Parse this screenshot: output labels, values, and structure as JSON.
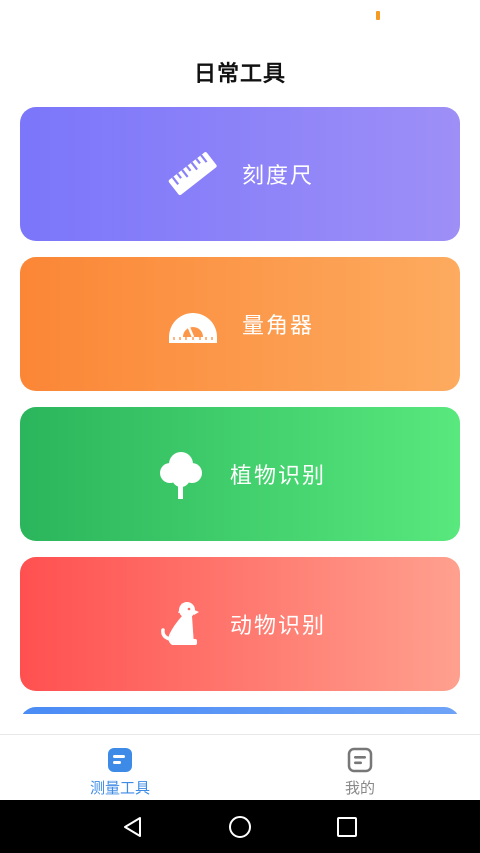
{
  "header": {
    "title": "日常工具"
  },
  "tools": [
    {
      "label": "刻度尺",
      "icon": "ruler-icon"
    },
    {
      "label": "量角器",
      "icon": "protractor-icon"
    },
    {
      "label": "植物识别",
      "icon": "tree-icon"
    },
    {
      "label": "动物识别",
      "icon": "dog-icon"
    }
  ],
  "tab_bar": {
    "tabs": [
      {
        "label": "测量工具",
        "icon": "document-icon",
        "active": true
      },
      {
        "label": "我的",
        "icon": "document-outline-icon",
        "active": false
      }
    ],
    "active_color": "#3d8be6",
    "inactive_color": "#888888"
  },
  "nav_bar": {
    "buttons": [
      "back-triangle-icon",
      "home-circle-icon",
      "recent-square-icon"
    ]
  },
  "colors": {
    "ruler_card": [
      "#7b76fa",
      "#9e8ff7"
    ],
    "protractor_card": [
      "#fb8636",
      "#fdab5f"
    ],
    "plant_card": [
      "#2bb55c",
      "#58e87d"
    ],
    "animal_card": [
      "#ff5050",
      "#ffa08e"
    ],
    "status_indicator": "#f59a23"
  }
}
